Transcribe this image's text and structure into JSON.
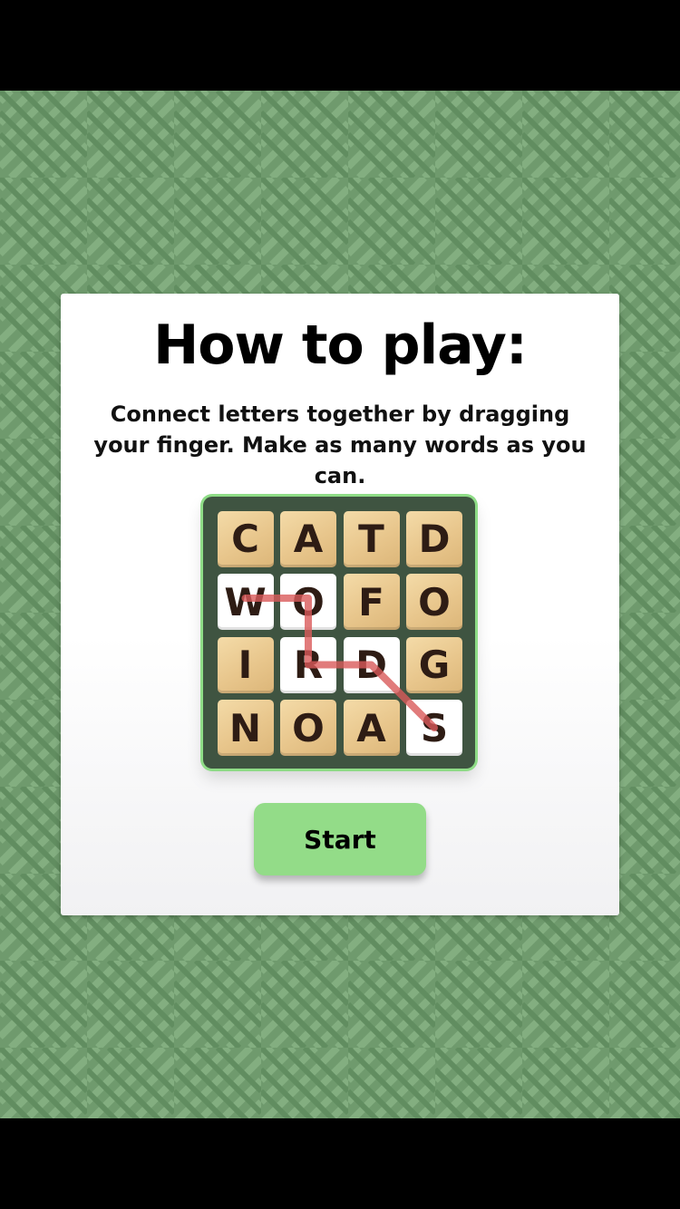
{
  "colors": {
    "background_green": "#6f9a6d",
    "pattern_light": "#82ad7f",
    "pattern_dark": "#5e8a5d",
    "board_dark": "#3f5441",
    "board_outline": "#8edc86",
    "tile_wood": "#ecca8f",
    "tile_selected": "#ffffff",
    "path_red": "#d95a5a",
    "button_green": "#93dc88"
  },
  "help_card": {
    "title": "How to play:",
    "instructions": "Connect letters together by dragging your finger. Make as many words as you can.",
    "start_label": "Start"
  },
  "board": {
    "tiles": [
      {
        "letter": "C",
        "selected": false
      },
      {
        "letter": "A",
        "selected": false
      },
      {
        "letter": "T",
        "selected": false
      },
      {
        "letter": "D",
        "selected": false
      },
      {
        "letter": "W",
        "selected": true
      },
      {
        "letter": "O",
        "selected": true
      },
      {
        "letter": "F",
        "selected": false
      },
      {
        "letter": "O",
        "selected": false
      },
      {
        "letter": "I",
        "selected": false
      },
      {
        "letter": "R",
        "selected": true
      },
      {
        "letter": "D",
        "selected": true
      },
      {
        "letter": "G",
        "selected": false
      },
      {
        "letter": "N",
        "selected": false
      },
      {
        "letter": "O",
        "selected": false
      },
      {
        "letter": "A",
        "selected": false
      },
      {
        "letter": "S",
        "selected": true
      }
    ],
    "example_word_path": [
      "W",
      "O",
      "R",
      "D",
      "S"
    ]
  }
}
